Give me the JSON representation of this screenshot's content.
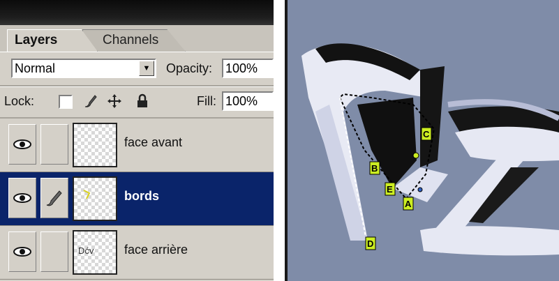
{
  "panel": {
    "tabs": [
      {
        "label": "Layers",
        "active": true
      },
      {
        "label": "Channels",
        "active": false
      }
    ],
    "blend_mode": "Normal",
    "opacity_label": "Opacity:",
    "opacity_value": "100%",
    "lock_label": "Lock:",
    "fill_label": "Fill:",
    "fill_value": "100%",
    "lock_icons": [
      "transparency-lock-icon",
      "brush-icon",
      "move-icon",
      "padlock-icon"
    ]
  },
  "layers": [
    {
      "name": "face avant",
      "visible": true,
      "selected": false,
      "linked_icon": "",
      "thumb_text": ""
    },
    {
      "name": "bords",
      "visible": true,
      "selected": true,
      "linked_icon": "brush-icon",
      "thumb_text": ""
    },
    {
      "name": "face arrière",
      "visible": true,
      "selected": false,
      "linked_icon": "",
      "thumb_text": "Dćv"
    }
  ],
  "canvas": {
    "background": "#7f8ca8",
    "shape_light": "#e4e6f2",
    "shape_dark": "#111111",
    "marker_color": "#ccee22",
    "markers": [
      "A",
      "B",
      "C",
      "D",
      "E"
    ]
  },
  "colors": {
    "panel_bg": "#d4d0c8",
    "selection": "#0a246a",
    "topbar": "#111111"
  }
}
